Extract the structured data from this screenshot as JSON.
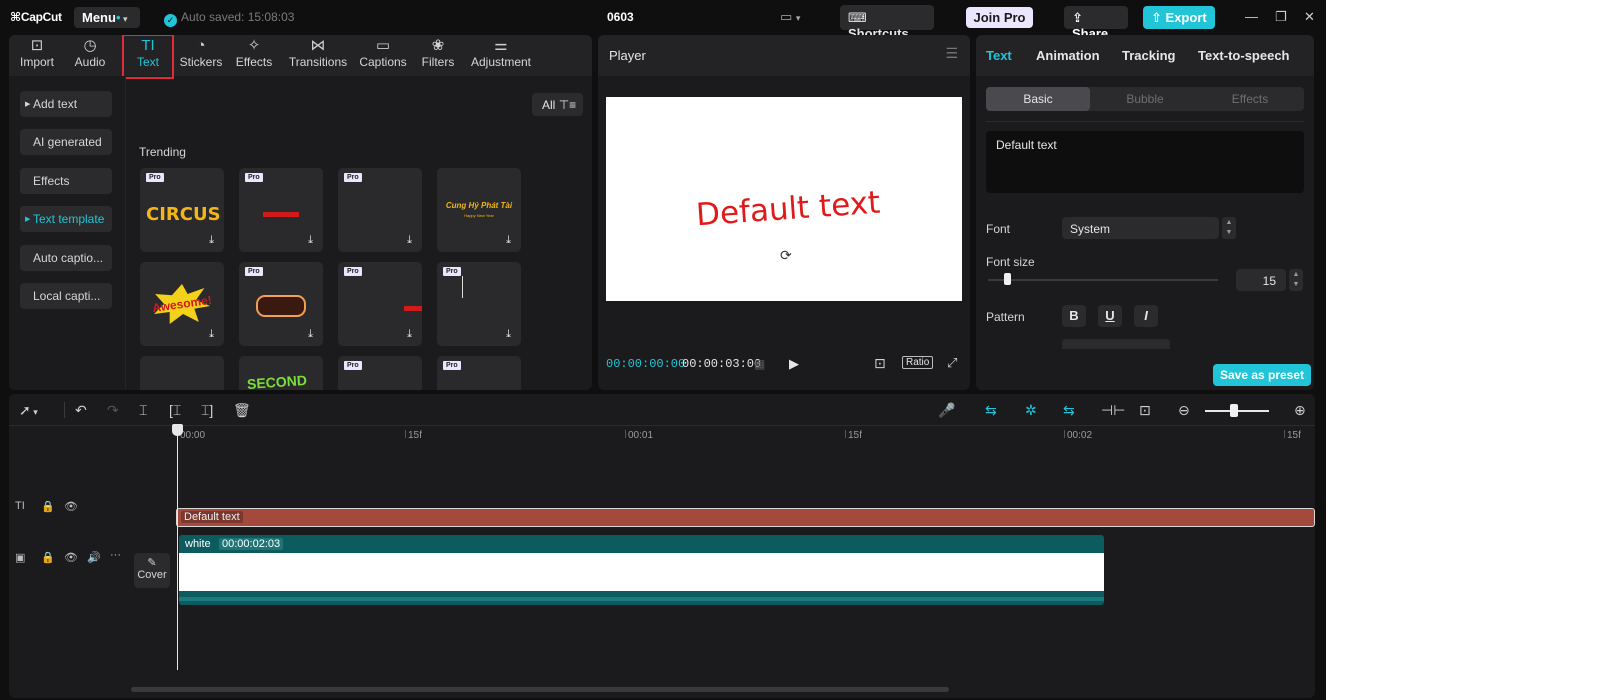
{
  "titlebar": {
    "logo": "CapCut",
    "menu_label": "Menu",
    "autosave": "Auto saved: 15:08:03",
    "project_name": "0603",
    "shortcuts_label": "Shortcuts",
    "join_pro_label": "Join Pro",
    "share_label": "Share",
    "export_label": "Export"
  },
  "left_tabs": [
    {
      "label": "Import",
      "icon": "import-icon"
    },
    {
      "label": "Audio",
      "icon": "audio-icon"
    },
    {
      "label": "Text",
      "icon": "text-icon",
      "active": true
    },
    {
      "label": "Stickers",
      "icon": "stickers-icon"
    },
    {
      "label": "Effects",
      "icon": "effects-icon"
    },
    {
      "label": "Transitions",
      "icon": "transitions-icon"
    },
    {
      "label": "Captions",
      "icon": "captions-icon"
    },
    {
      "label": "Filters",
      "icon": "filters-icon"
    },
    {
      "label": "Adjustment",
      "icon": "adjustment-icon"
    }
  ],
  "sidebar": {
    "items": [
      {
        "label": "Add text"
      },
      {
        "label": "AI generated"
      },
      {
        "label": "Effects"
      },
      {
        "label": "Text template",
        "active": true
      },
      {
        "label": "Auto captio..."
      },
      {
        "label": "Local capti..."
      }
    ]
  },
  "filter": {
    "label": "All"
  },
  "trending": {
    "title": "Trending",
    "pro_badge": "Pro",
    "tiles": [
      {
        "text": "CIRCUS"
      },
      {
        "text": ""
      },
      {
        "text": ""
      },
      {
        "text": "Cung Hỷ Phát Tài",
        "subtext": "Happy New Year"
      },
      {
        "text": "Awesome!"
      },
      {
        "text": ""
      },
      {
        "text": ""
      },
      {
        "text": ""
      },
      {
        "text": ""
      },
      {
        "text": "SECOND"
      },
      {
        "text": ""
      },
      {
        "text": ""
      }
    ]
  },
  "player": {
    "title": "Player",
    "canvas_text": "Default text",
    "time_current": "00:00:00:00",
    "time_total": "00:00:03:00",
    "ratio_label": "Ratio"
  },
  "right_panel": {
    "tabs": [
      "Text",
      "Animation",
      "Tracking",
      "Text-to-speech"
    ],
    "segments": [
      "Basic",
      "Bubble",
      "Effects"
    ],
    "text_value": "Default text",
    "font_label": "Font",
    "font_value": "System",
    "font_size_label": "Font size",
    "font_size_value": "15",
    "pattern_label": "Pattern",
    "pattern_buttons": [
      "B",
      "U",
      "I"
    ],
    "save_preset_label": "Save as preset"
  },
  "timeline": {
    "ruler": [
      "00:00",
      "15f",
      "00:01",
      "15f",
      "00:02",
      "15f"
    ],
    "text_clip_label": "Default text",
    "video_clip_name": "white",
    "video_clip_duration": "00:00:02:03",
    "cover_label": "Cover"
  },
  "colors": {
    "accent": "#22c5d8",
    "text_clip": "#a44a3c",
    "video_clip": "#0c5b5e",
    "canvas_text": "#e01a1a",
    "highlight_box": "#e02b3a"
  }
}
